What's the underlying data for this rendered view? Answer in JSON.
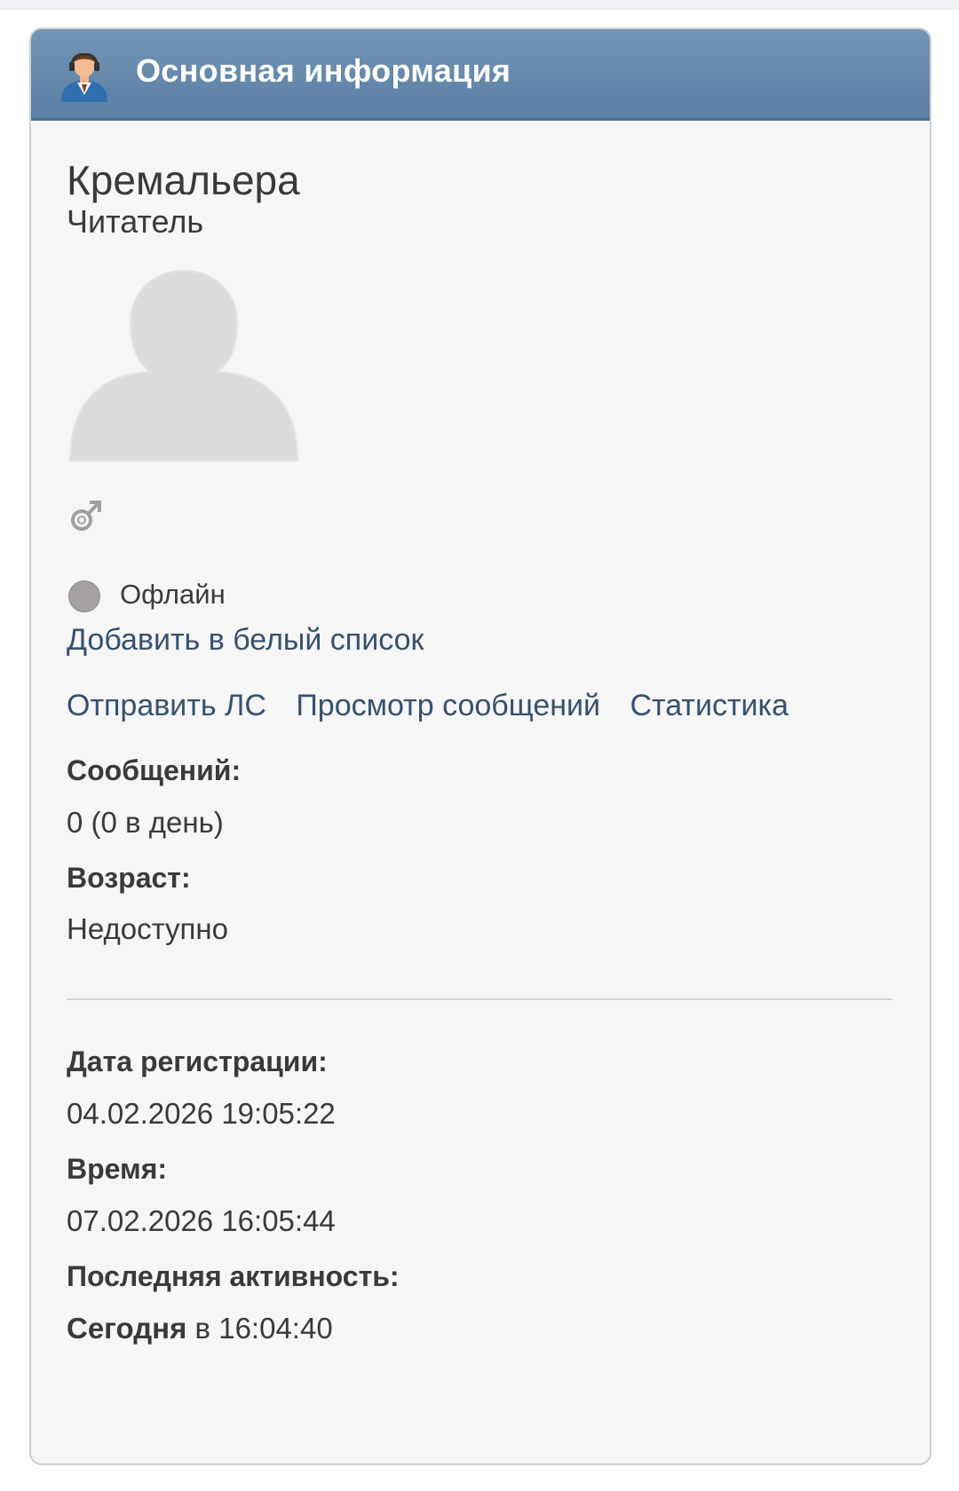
{
  "header": {
    "title": "Основная информация",
    "icon": "user-profile-icon"
  },
  "profile": {
    "username": "Кремальера",
    "rank": "Читатель",
    "avatar": "default-avatar-placeholder",
    "gender_icon": "male-gender-icon",
    "status": {
      "text": "Офлайн",
      "color": "#a4a0a4"
    }
  },
  "links": {
    "whitelist": "Добавить в белый список",
    "send_pm": "Отправить ЛС",
    "view_posts": "Просмотр сообщений",
    "statistics": "Статистика"
  },
  "details": {
    "posts_label": "Сообщений:",
    "posts_value": "0 (0 в день)",
    "age_label": "Возраст:",
    "age_value": "Недоступно",
    "registered_label": "Дата регистрации:",
    "registered_value": "04.02.2026 19:05:22",
    "time_label": "Время:",
    "time_value": "07.02.2026 16:05:44",
    "last_active_label": "Последняя активность:",
    "last_active_day": "Сегодня",
    "last_active_time": " в 16:04:40"
  },
  "colors": {
    "header_start": "#7395b6",
    "header_end": "#5a7fa3",
    "link": "#36516f",
    "panel_bg": "#f6f6f6"
  }
}
